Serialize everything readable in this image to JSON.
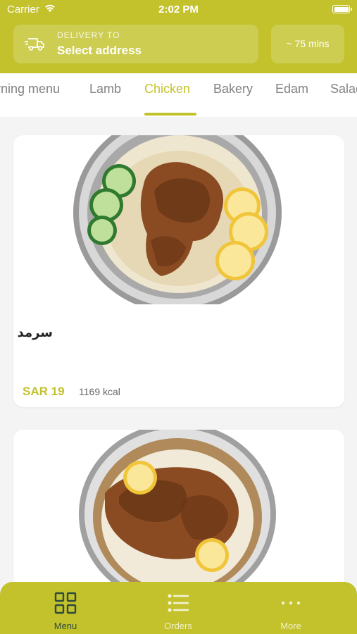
{
  "status_bar": {
    "carrier": "Carrier",
    "time": "2:02 PM",
    "battery_level": 1.0
  },
  "header": {
    "delivery_label": "DELIVERY TO",
    "delivery_value": "Select address",
    "eta": "~ 75 mins",
    "accent_color": "#c3c22d"
  },
  "tabs": {
    "items": [
      "rning menu",
      "Lamb",
      "Chicken",
      "Bakery",
      "Edam",
      "Salad"
    ],
    "active": "Chicken"
  },
  "products": [
    {
      "name": "سرمد",
      "price": "SAR 19",
      "kcal": "1169 kcal",
      "image": "chicken-rice-plate"
    },
    {
      "image": "chicken-rice-plate"
    }
  ],
  "bottom_nav": {
    "items": [
      {
        "label": "Menu",
        "icon": "grid-icon"
      },
      {
        "label": "Orders",
        "icon": "list-icon"
      },
      {
        "label": "More",
        "icon": "more-icon"
      }
    ],
    "active": "Menu"
  }
}
